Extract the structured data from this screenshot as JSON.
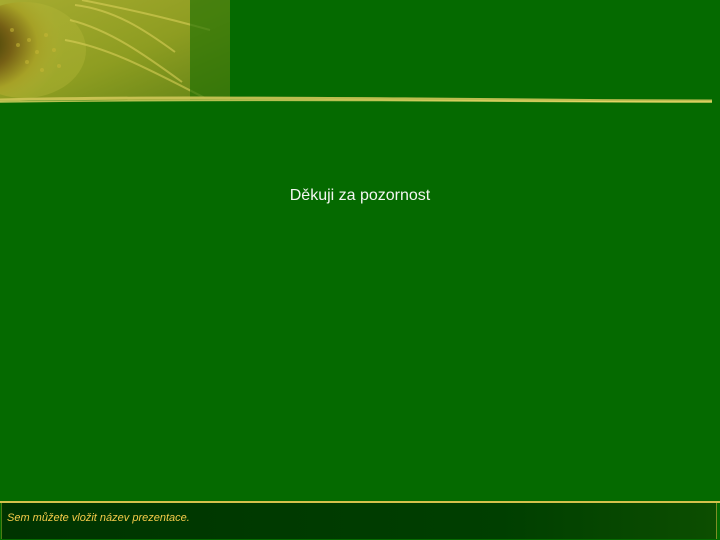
{
  "slide": {
    "body_text": "Děkuji za pozornost",
    "footer_text": "Sem můžete vložit název prezentace.",
    "header_image": "sunflower-photo",
    "background_color": "#056a00",
    "footer_text_color": "#f6cc4a",
    "accent_line_color": "#d4c24b"
  }
}
